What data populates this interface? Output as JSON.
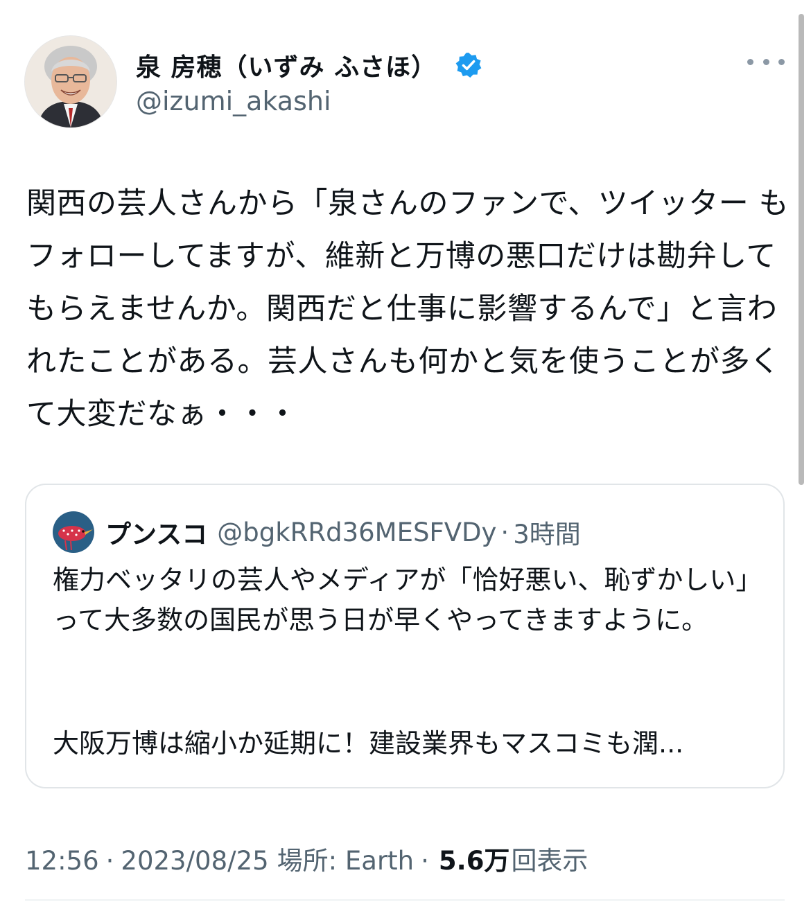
{
  "author": {
    "display_name": "泉 房穂（いずみ ふさほ）",
    "handle": "@izumi_akashi",
    "verified_icon": "verified-badge-icon",
    "avatar_icon": "profile-photo"
  },
  "more_icon": "more-options-icon",
  "tweet": {
    "text": "関西の芸人さんから「泉さんのファンで、ツイッター もフォローしてますが、維新と万博の悪口だけは勘弁してもらえませんか。関西だと仕事に影響するんで」と言われたことがある。芸人さんも何かと気を使うことが多くて大変だなぁ・・・"
  },
  "quote": {
    "name": "プンスコ",
    "handle": "@bgkRRd36MESFVDy",
    "separator": "·",
    "time": "3時間",
    "text": "権力ベッタリの芸人やメディアが「恰好悪い、恥ずかしい」って大多数の国民が思う日が早くやってきますように。",
    "text_continued": "大阪万博は縮小か延期に！建設業界もマスコミも潤..."
  },
  "meta": {
    "time": "12:56",
    "separator": "·",
    "date": "2023/08/25",
    "location": "場所: Earth",
    "views_count": "5.6万",
    "views_label": "回表示"
  },
  "colors": {
    "verified": "#1d9bf0",
    "secondary_text": "#536471",
    "primary_text": "#0f1419",
    "border": "#e1e5e8"
  }
}
